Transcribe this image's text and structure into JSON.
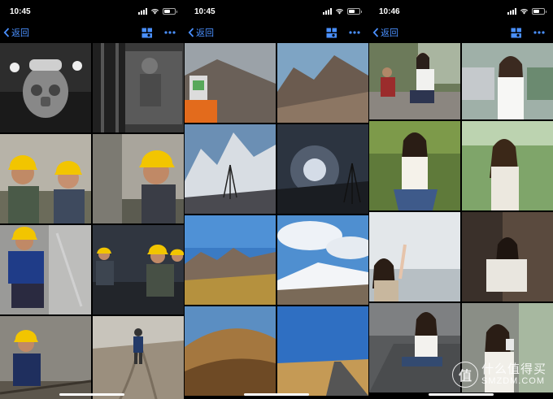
{
  "colors": {
    "accent": "#4a90ff",
    "background": "#000000"
  },
  "panels": [
    {
      "time": "10:45",
      "back_label": "返回",
      "battery_level": 0.55,
      "icons": [
        "signal-icon",
        "wifi-icon",
        "battery-icon",
        "gallery-view-icon",
        "more-icon"
      ],
      "photos": [
        "Miner wearing gas mask",
        "Miner at shaft",
        "Two workers in yellow hardhats",
        "Smiling worker in yellow hardhat",
        "Worker in blue jacket sitting",
        "Workers in tunnel",
        "Worker squatting on rails",
        "Worker walking on dirt road"
      ]
    },
    {
      "time": "10:45",
      "back_label": "返回",
      "battery_level": 0.55,
      "icons": [
        "signal-icon",
        "wifi-icon",
        "battery-icon",
        "gallery-view-icon",
        "more-icon"
      ],
      "photos": [
        "Survey instrument on rocks",
        "Rocky desert mountains",
        "Snowy mountain with tripod",
        "Tripod under glowing sky",
        "Layered mountains at sunset",
        "Snow peak and clouds",
        "Golden hillside",
        "Road through desert"
      ]
    },
    {
      "time": "10:46",
      "back_label": "返回",
      "battery_level": 0.55,
      "icons": [
        "signal-icon",
        "wifi-icon",
        "battery-icon",
        "gallery-view-icon",
        "more-icon"
      ],
      "photos": [
        "Woman sitting on bench",
        "Woman in white shirt",
        "Woman in grass holding hair",
        "Woman smiling outdoors",
        "Woman by river raising hand",
        "Woman leaning on wall",
        "Woman sitting on steps",
        "Woman drinking from cup"
      ]
    }
  ],
  "watermark": {
    "cn": "什么值得买",
    "en": "SMZDM.COM",
    "badge": "值"
  }
}
